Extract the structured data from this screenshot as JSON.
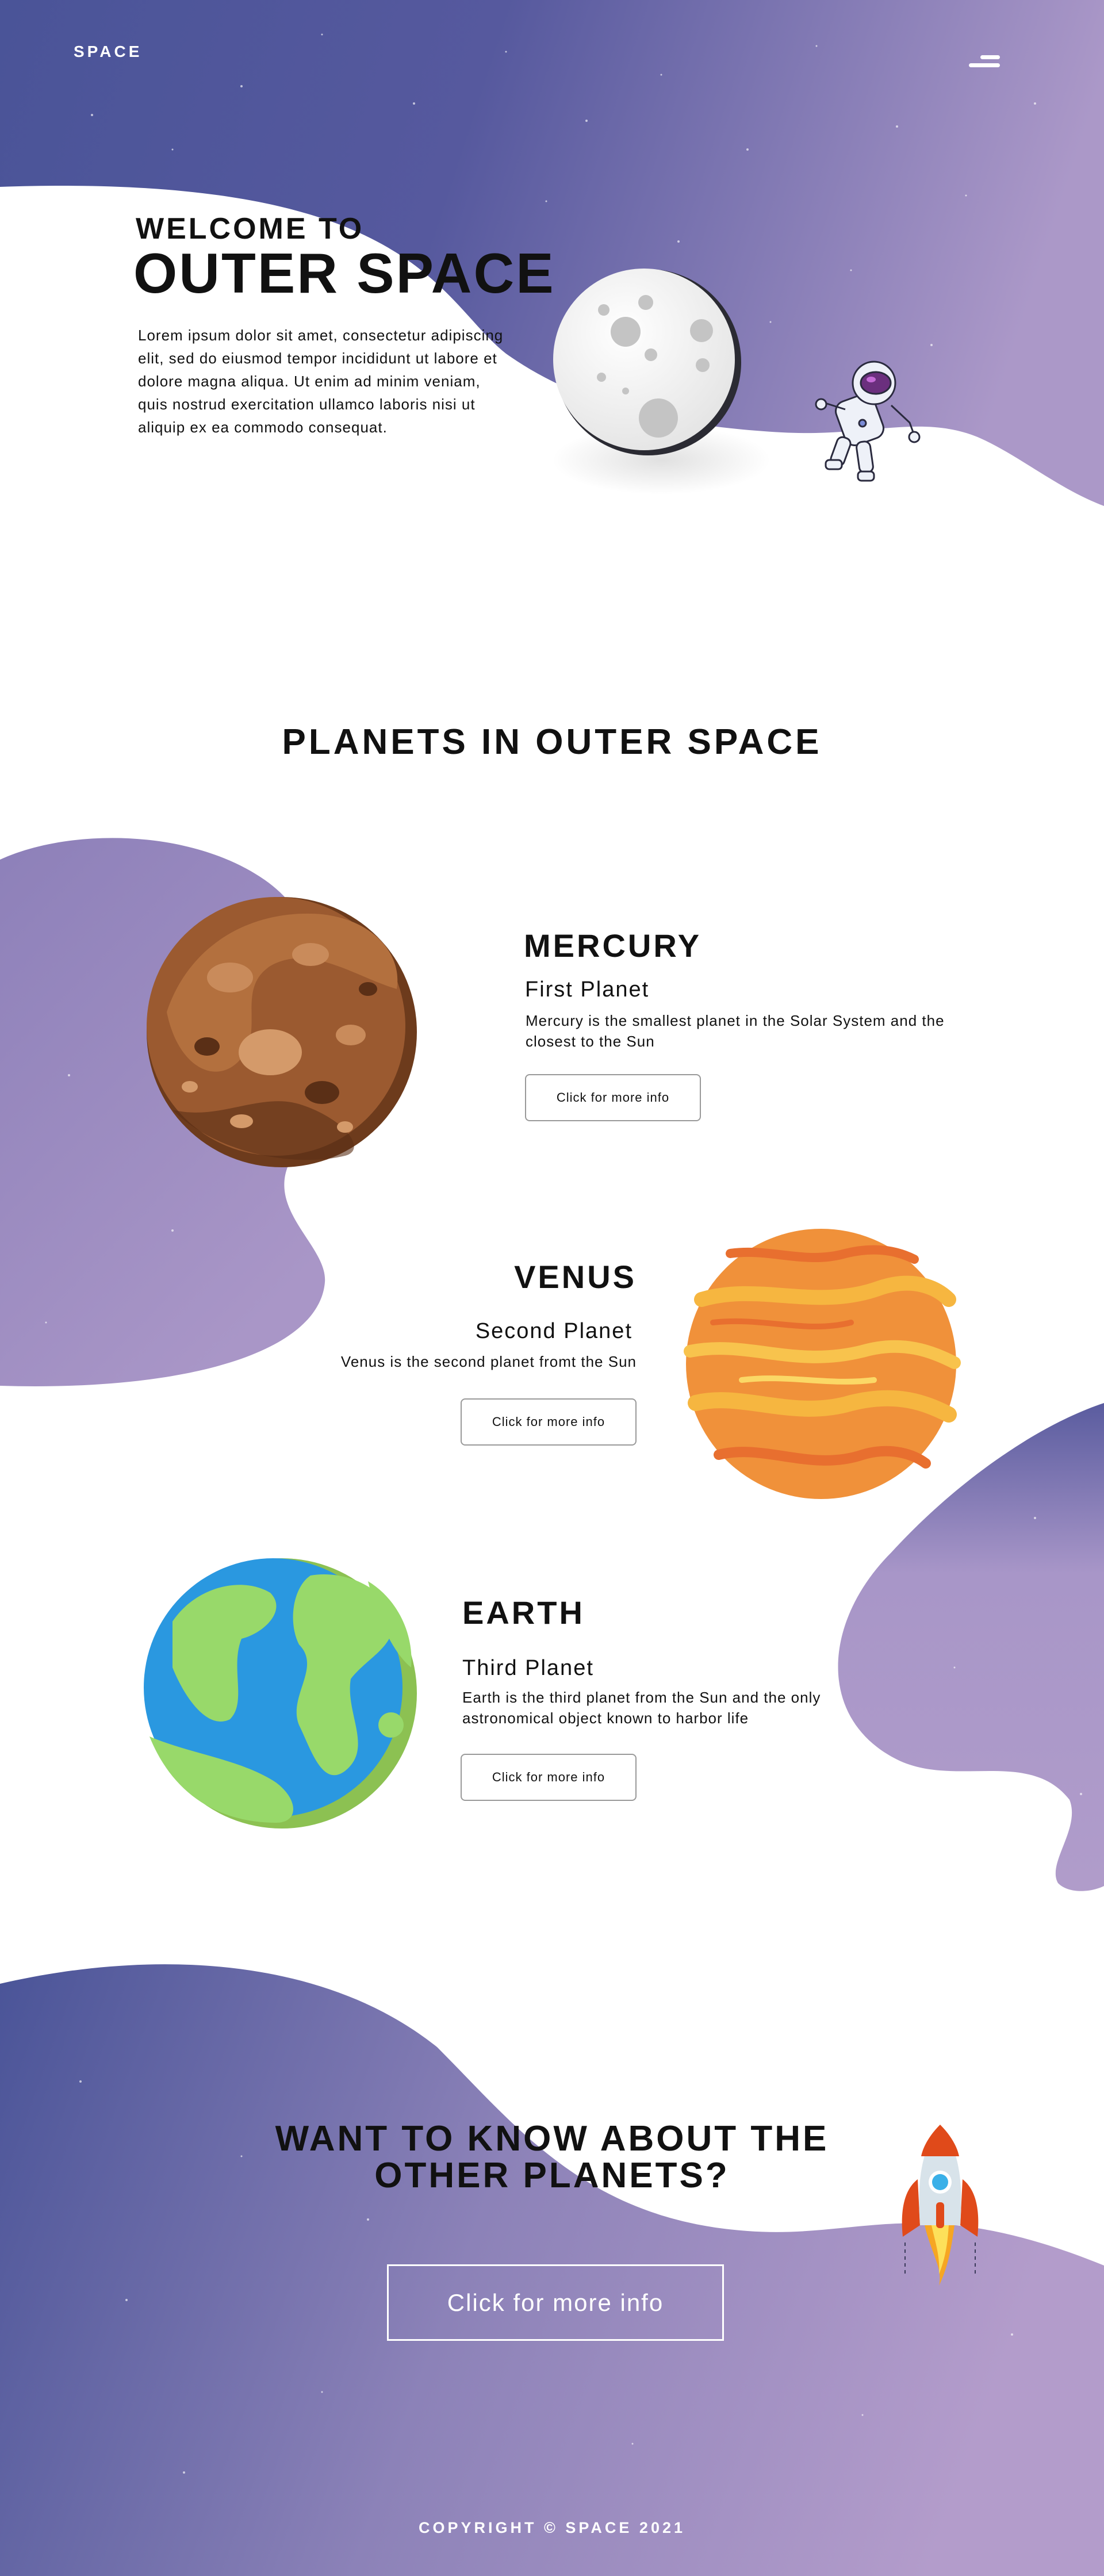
{
  "header": {
    "logo": "SPACE"
  },
  "hero": {
    "subtitle": "WELCOME TO",
    "title": "OUTER SPACE",
    "text": "Lorem ipsum dolor sit amet, consectetur adipiscing elit, sed do eiusmod tempor incididunt ut labore et dolore magna aliqua. Ut enim ad minim veniam, quis nostrud exercitation ullamco laboris nisi ut aliquip ex ea commodo consequat."
  },
  "planets": {
    "section_title": "PLANETS IN OUTER SPACE",
    "items": [
      {
        "name": "MERCURY",
        "order": "First Planet",
        "description": "Mercury is the smallest planet in the Solar System and the closest to the Sun",
        "button": "Click for more info"
      },
      {
        "name": "VENUS",
        "order": "Second Planet",
        "description": "Venus is the second planet fromt the Sun",
        "button": "Click for more info"
      },
      {
        "name": "EARTH",
        "order": "Third Planet",
        "description": "Earth is the third planet from the Sun and the only astronomical object known to harbor life",
        "button": "Click for more info"
      }
    ]
  },
  "cta": {
    "title_line1": "WANT TO KNOW ABOUT THE",
    "title_line2": "OTHER PLANETS?",
    "button": "Click for more info"
  },
  "footer": {
    "copyright": "COPYRIGHT © SPACE 2021"
  },
  "colors": {
    "indigo": "#4a5498",
    "lavender": "#b29ccb",
    "text": "#111111",
    "button_border": "#999999"
  },
  "icons": [
    "menu-icon",
    "moon-icon",
    "astronaut-icon",
    "mercury-planet",
    "venus-planet",
    "earth-planet",
    "rocket-icon"
  ]
}
